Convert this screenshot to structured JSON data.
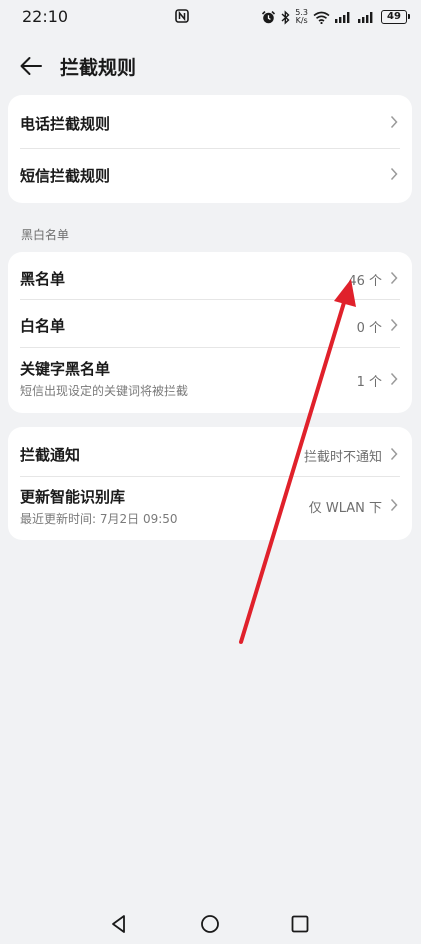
{
  "status_bar": {
    "time": "22:10",
    "net_speed_value": "5.3",
    "net_speed_unit": "K/s",
    "battery": "49"
  },
  "header": {
    "title": "拦截规则"
  },
  "card1": {
    "items": [
      {
        "title": "电话拦截规则"
      },
      {
        "title": "短信拦截规则"
      }
    ]
  },
  "section": {
    "label": "黑白名单"
  },
  "card2": {
    "items": [
      {
        "title": "黑名单",
        "value": "46 个"
      },
      {
        "title": "白名单",
        "value": "0 个"
      },
      {
        "title": "关键字黑名单",
        "subtitle": "短信出现设定的关键词将被拦截",
        "value": "1 个"
      }
    ]
  },
  "card3": {
    "items": [
      {
        "title": "拦截通知",
        "value": "拦截时不通知"
      },
      {
        "title": "更新智能识别库",
        "subtitle": "最近更新时间: 7月2日 09:50",
        "value": "仅 WLAN 下"
      }
    ]
  },
  "colors": {
    "background": "#f1f2f4",
    "card": "#ffffff",
    "annotation_arrow": "#e0212b"
  }
}
